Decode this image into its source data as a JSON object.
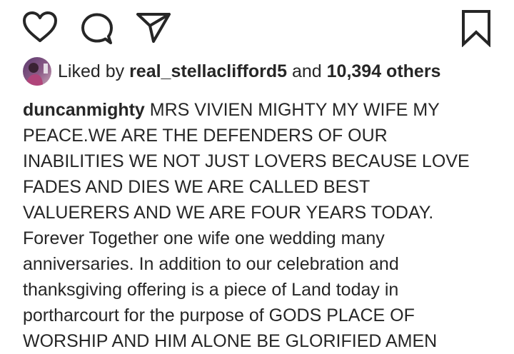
{
  "actions": {
    "like_icon": "heart-icon",
    "comment_icon": "speech-bubble-icon",
    "share_icon": "paper-plane-icon",
    "save_icon": "bookmark-icon"
  },
  "likes": {
    "avatar_icon": "profile-avatar",
    "prefix": "Liked by",
    "username": "real_stellaclifford5",
    "and": "and",
    "count": "10,394 others"
  },
  "caption": {
    "username": "duncanmighty",
    "lines": [
      "MRS VIVIEN MIGHTY MY WIFE MY",
      "PEACE.WE ARE THE DEFENDERS OF OUR",
      "INABILITIES WE NOT JUST LOVERS BECAUSE LOVE",
      "FADES AND DIES WE ARE CALLED BEST",
      "VALUERERS AND WE ARE FOUR YEARS TODAY.",
      "Forever Together one wife one wedding many",
      "anniversaries. In addition to our celebration and",
      "thanksgiving offering is a piece of Land today in",
      "portharcourt for the purpose of GODS PLACE OF",
      "WORSHIP AND HIM ALONE BE GLORIFIED AMEN"
    ]
  },
  "colors": {
    "text": "#262626",
    "background": "#ffffff"
  }
}
